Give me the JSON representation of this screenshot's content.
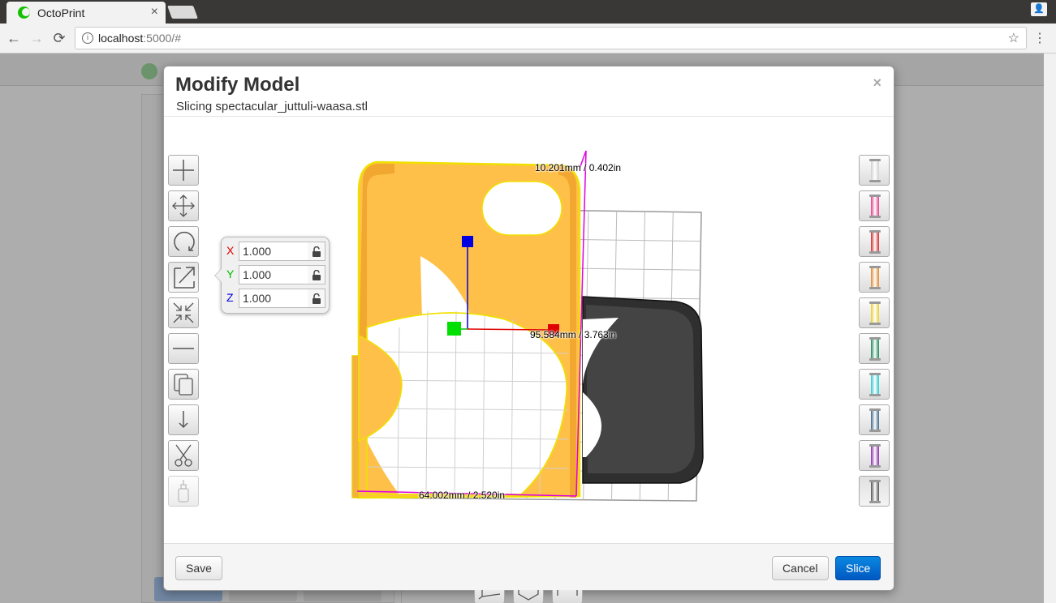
{
  "browser": {
    "tab_title": "OctoPrint",
    "tab_close": "×",
    "url_host": "localhost",
    "url_rest": ":5000/#",
    "info_icon": "i",
    "star_icon": "☆",
    "menu_icon": "⋮",
    "back_icon": "←",
    "forward_icon": "→",
    "reload_icon": "⟳",
    "profile_icon": "👤"
  },
  "modal": {
    "title": "Modify Model",
    "subtitle": "Slicing spectacular_juttuli-waasa.stl",
    "close": "×"
  },
  "tools": [
    "add",
    "translate",
    "rotate",
    "scale",
    "shrink-to-fit",
    "lay-flat",
    "duplicate",
    "drop-to-bed",
    "cut",
    "glue"
  ],
  "scale": {
    "x": {
      "label": "X",
      "value": "1.000",
      "color": "#e00000"
    },
    "y": {
      "label": "Y",
      "value": "1.000",
      "color": "#00c000"
    },
    "z": {
      "label": "Z",
      "value": "1.000",
      "color": "#0000e0"
    }
  },
  "dimensions": {
    "height": "10.201mm / 0.402in",
    "depth": "95.584mm / 3.763in",
    "width": "64.002mm / 2.520in"
  },
  "filaments": [
    {
      "color": "#d0d0d0"
    },
    {
      "color": "#e0408a"
    },
    {
      "color": "#d03030"
    },
    {
      "color": "#e08a30"
    },
    {
      "color": "#e8d030"
    },
    {
      "color": "#208a5a"
    },
    {
      "color": "#30c8d0"
    },
    {
      "color": "#406a8a"
    },
    {
      "color": "#8a30a8"
    },
    {
      "color": "#555555"
    }
  ],
  "view_buttons": [
    "axes-view",
    "hexagon-view",
    "measure-view"
  ],
  "footer": {
    "save": "Save",
    "cancel": "Cancel",
    "slice": "Slice"
  }
}
